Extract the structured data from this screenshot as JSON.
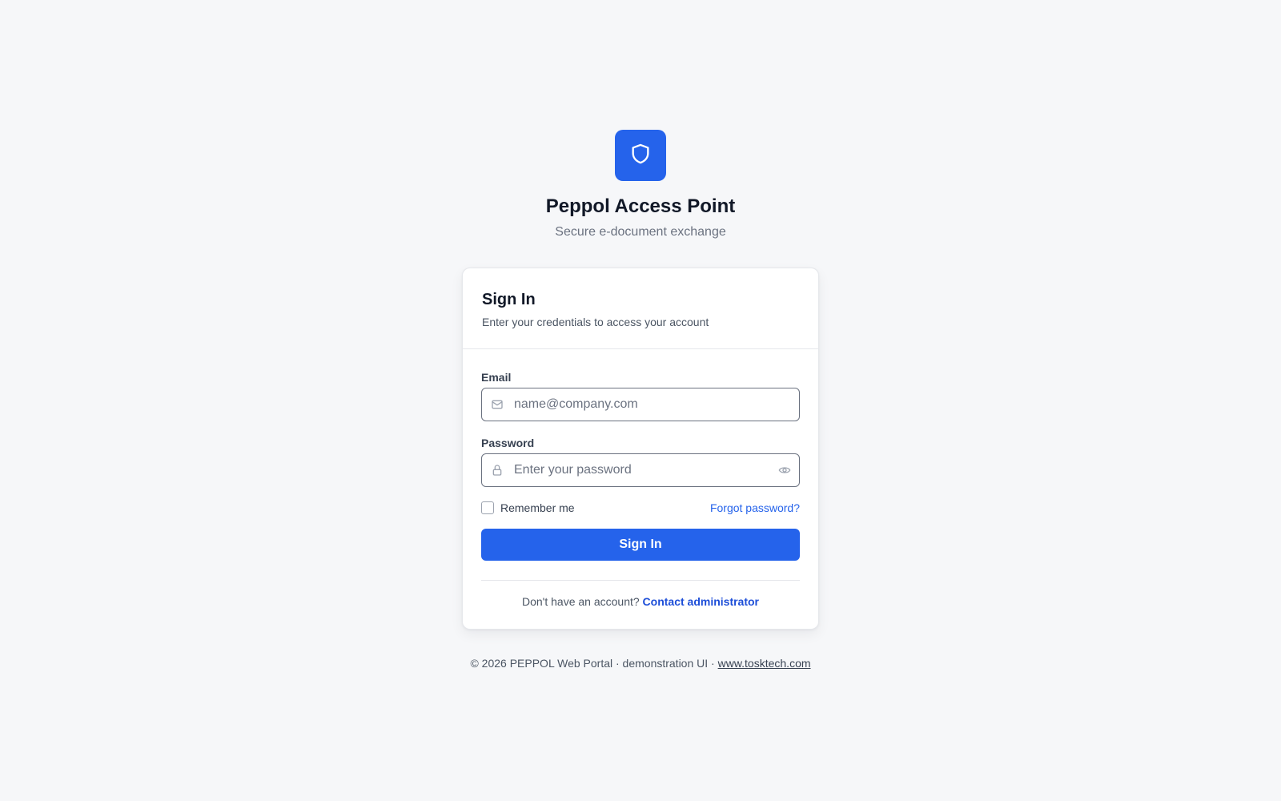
{
  "brand": {
    "logo_icon": "shield-icon",
    "title": "Peppol Access Point",
    "subtitle": "Secure e-document exchange",
    "accent_color": "#2563eb"
  },
  "card": {
    "title": "Sign In",
    "description": "Enter your credentials to access your account"
  },
  "form": {
    "email": {
      "label": "Email",
      "placeholder": "name@company.com",
      "value": "",
      "icon": "mail-icon"
    },
    "password": {
      "label": "Password",
      "placeholder": "Enter your password",
      "value": "",
      "icon": "lock-icon",
      "toggle_icon": "eye-icon"
    },
    "remember_label": "Remember me",
    "remember_checked": false,
    "forgot_label": "Forgot password?",
    "submit_label": "Sign In"
  },
  "signup": {
    "prompt": "Don't have an account?",
    "link_label": "Contact administrator"
  },
  "footer": {
    "text": "© 2026 PEPPOL Web Portal · demonstration UI ·",
    "link_label": "www.tosktech.com"
  }
}
